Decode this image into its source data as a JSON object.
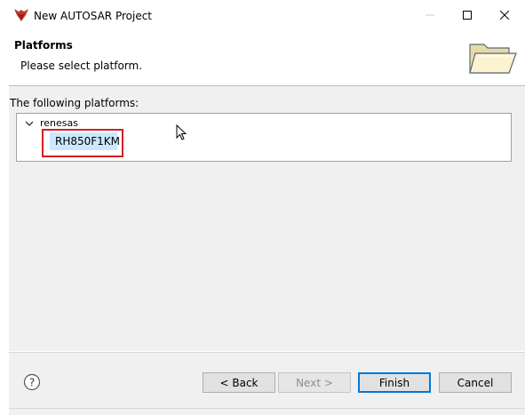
{
  "window": {
    "title": "New AUTOSAR Project",
    "controls": {
      "minimize_icon": "minimize-icon",
      "maximize_icon": "maximize-icon",
      "close_icon": "close-icon"
    }
  },
  "header": {
    "title": "Platforms",
    "subtitle": "Please select platform.",
    "icon": "folder-icon"
  },
  "content": {
    "section_label": "The following platforms:",
    "tree": [
      {
        "label": "renesas",
        "expanded": true,
        "children": [
          {
            "label": "RH850F1KM",
            "selected": true
          }
        ]
      }
    ]
  },
  "footer": {
    "help_icon": "help-icon",
    "buttons": {
      "back": "< Back",
      "next": "Next >",
      "finish": "Finish",
      "cancel": "Cancel"
    },
    "next_enabled": false,
    "default_button": "finish"
  },
  "colors": {
    "selection": "#cce8ff",
    "highlight_border": "#d41e1e",
    "default_button_border": "#0078d7",
    "dialog_bg": "#f0f0f0"
  }
}
